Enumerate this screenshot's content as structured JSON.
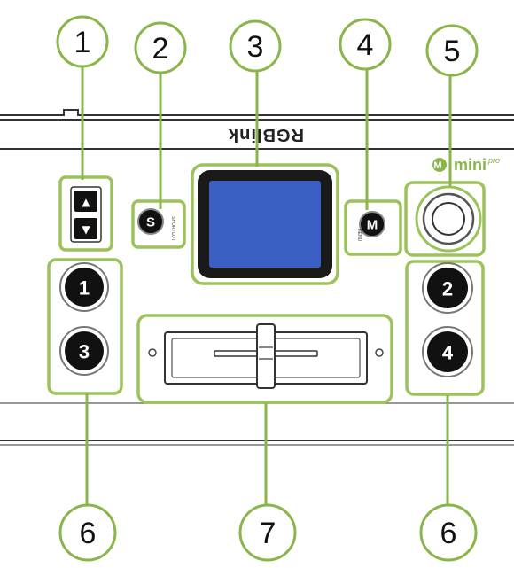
{
  "brand": "RGBlink",
  "model_logo": {
    "main": "mini",
    "suffix": "pro"
  },
  "callouts": [
    "1",
    "2",
    "3",
    "4",
    "5",
    "6",
    "7",
    "6"
  ],
  "buttons": {
    "shortcut_key": "S",
    "shortcut_caption": "SHORTCUT",
    "menu_key": "M",
    "menu_caption": "MENU",
    "inputs": [
      "1",
      "3",
      "2",
      "4"
    ]
  },
  "arrows": {
    "up": "▲",
    "down": "▼"
  },
  "colors": {
    "highlight": "#9cc25b",
    "screen": "#3a5fc4",
    "button": "#111111",
    "logo": "#8ab54a"
  }
}
